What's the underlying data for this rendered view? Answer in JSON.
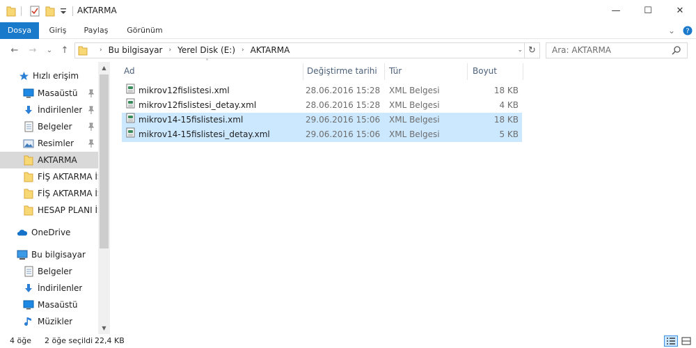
{
  "window": {
    "title": "AKTARMA",
    "minimize": "—",
    "maximize": "☐",
    "close": "✕"
  },
  "ribbon": {
    "tabs": [
      "Dosya",
      "Giriş",
      "Paylaş",
      "Görünüm"
    ],
    "expand": "⌄",
    "help": "?"
  },
  "nav": {
    "back": "←",
    "forward": "→",
    "recent": "⌄",
    "up": "↑",
    "breadcrumbs": [
      "Bu bilgisayar",
      "Yerel Disk (E:)",
      "AKTARMA"
    ],
    "crumb_sep": "›",
    "dropdown": "⌄",
    "refresh": "↻",
    "search_placeholder": "Ara: AKTARMA"
  },
  "sidebar": {
    "items": [
      {
        "label": "Hızlı erişim",
        "icon": "star-icon"
      },
      {
        "label": "Masaüstü",
        "icon": "desktop-icon"
      },
      {
        "label": "İndirilenler",
        "icon": "download-icon"
      },
      {
        "label": "Belgeler",
        "icon": "document-icon"
      },
      {
        "label": "Resimler",
        "icon": "pictures-icon"
      },
      {
        "label": "AKTARMA",
        "icon": "folder-icon"
      },
      {
        "label": "FİŞ AKTARMA İŞ",
        "icon": "folder-icon"
      },
      {
        "label": "FİŞ AKTARMA İŞ",
        "icon": "folder-icon"
      },
      {
        "label": "HESAP PLANI İŞİ",
        "icon": "folder-icon"
      },
      {
        "label": "OneDrive",
        "icon": "onedrive-icon"
      },
      {
        "label": "Bu bilgisayar",
        "icon": "computer-icon"
      },
      {
        "label": "Belgeler",
        "icon": "document-icon"
      },
      {
        "label": "İndirilenler",
        "icon": "download-icon"
      },
      {
        "label": "Masaüstü",
        "icon": "desktop-icon"
      },
      {
        "label": "Müzikler",
        "icon": "music-icon"
      }
    ],
    "scroll_up": "▲",
    "scroll_down": "▼"
  },
  "columns": {
    "name": "Ad",
    "date": "Değiştirme tarihi",
    "type": "Tür",
    "size": "Boyut",
    "sort": "˄"
  },
  "files": [
    {
      "name": "mikrov12fislistesi.xml",
      "date": "28.06.2016 15:28",
      "type": "XML Belgesi",
      "size": "18 KB",
      "selected": false
    },
    {
      "name": "mikrov12fislistesi_detay.xml",
      "date": "28.06.2016 15:28",
      "type": "XML Belgesi",
      "size": "4 KB",
      "selected": false
    },
    {
      "name": "mikrov14-15fislistesi.xml",
      "date": "29.06.2016 15:06",
      "type": "XML Belgesi",
      "size": "18 KB",
      "selected": true
    },
    {
      "name": "mikrov14-15fislistesi_detay.xml",
      "date": "29.06.2016 15:06",
      "type": "XML Belgesi",
      "size": "5 KB",
      "selected": true
    }
  ],
  "status": {
    "count": "4 öğe",
    "selected": "2 öğe seçildi",
    "size": "22,4 KB"
  },
  "colors": {
    "accent": "#1979ca",
    "selection": "#cce8ff",
    "folder": "#f8d775"
  }
}
